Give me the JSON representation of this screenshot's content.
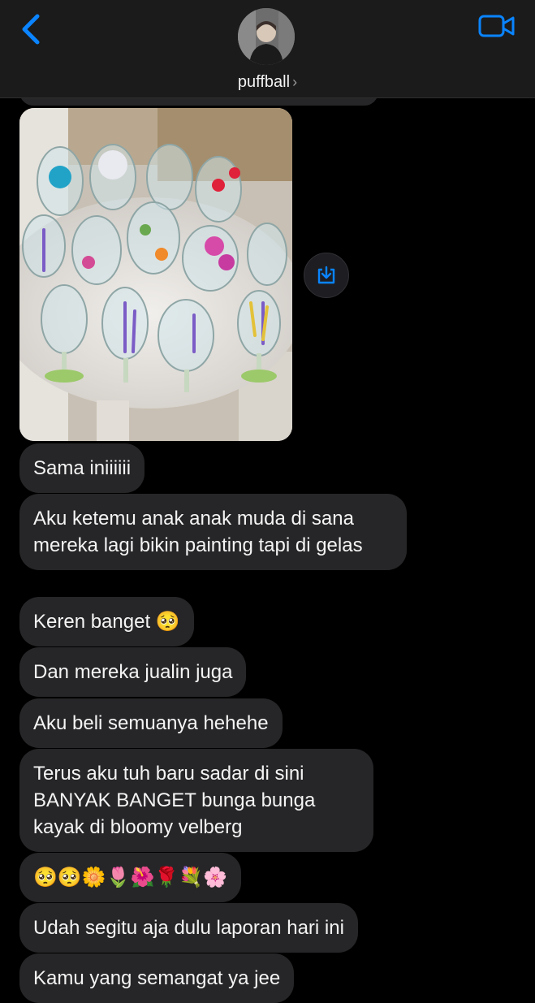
{
  "header": {
    "contact_name": "puffball",
    "name_chevron": "›",
    "back_icon": "chevron-left-icon",
    "video_icon": "video-camera-icon",
    "accent_color": "#0a84ff"
  },
  "thread": {
    "image_message": {
      "save_icon": "download-to-tray-icon"
    },
    "messages": [
      {
        "text": "Sama iniiiiii"
      },
      {
        "text": "Aku ketemu anak anak muda di sana mereka lagi bikin painting tapi di gelas"
      },
      {
        "text": "Keren banget 🥺"
      },
      {
        "text": "Dan mereka jualin juga"
      },
      {
        "text": "Aku beli semuanya hehehe"
      },
      {
        "text": "Terus aku tuh baru sadar di sini BANYAK BANGET bunga bunga kayak di bloomy velberg"
      },
      {
        "text": "🥺🥺🌼🌷🌺🌹💐🌸"
      },
      {
        "text": "Udah segitu aja dulu laporan hari ini"
      },
      {
        "text": "Kamu yang semangat ya jee"
      }
    ],
    "bubble_color": "#262628"
  }
}
